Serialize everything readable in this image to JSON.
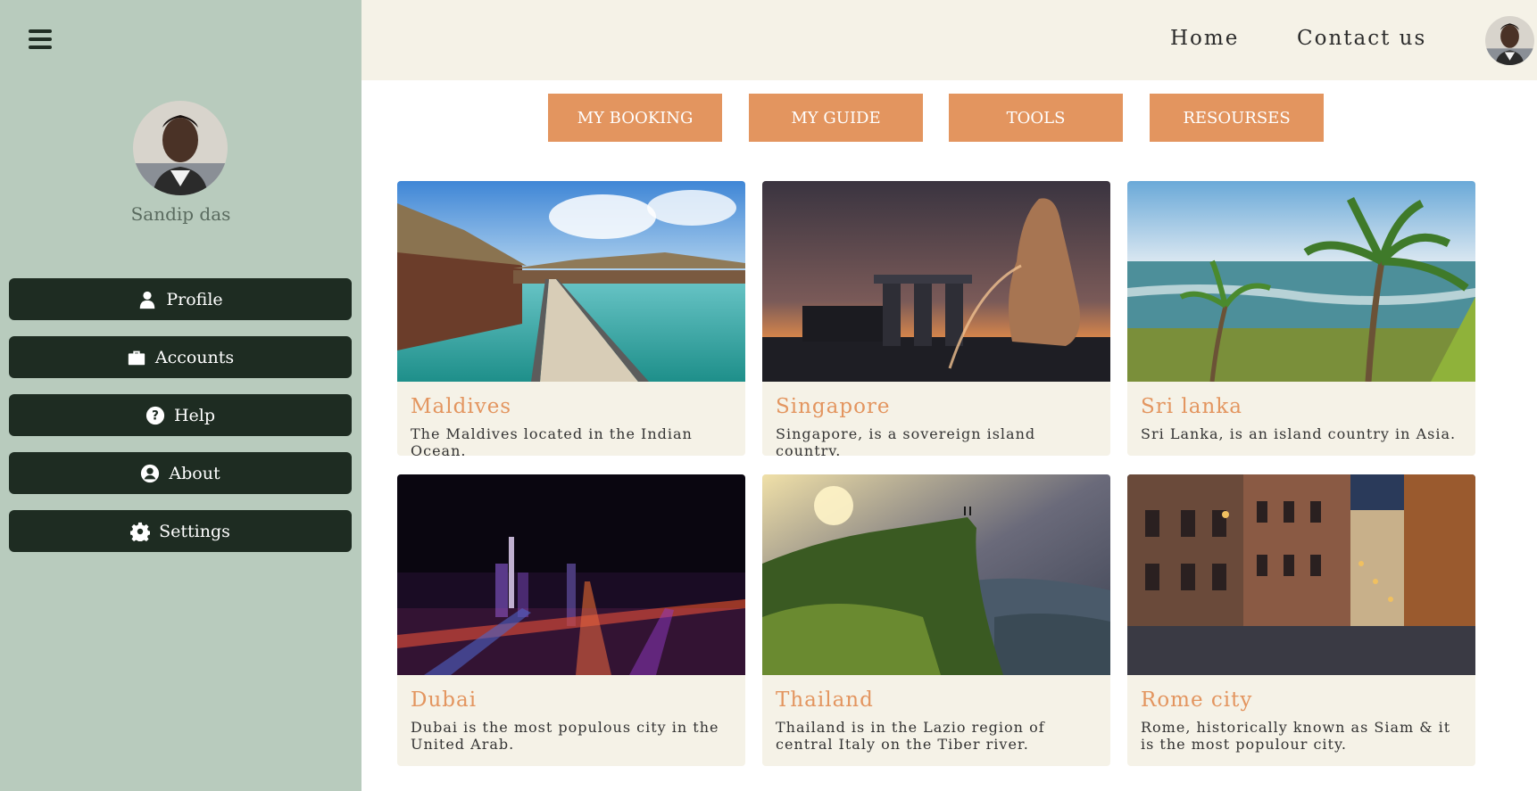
{
  "sidebar": {
    "menu_icon": "hamburger-icon",
    "user_name": "Sandip das",
    "items": [
      {
        "label": "Profile",
        "icon": "user-icon"
      },
      {
        "label": "Accounts",
        "icon": "briefcase-icon"
      },
      {
        "label": "Help",
        "icon": "question-icon"
      },
      {
        "label": "About",
        "icon": "user-circle-icon"
      },
      {
        "label": "Settings",
        "icon": "gear-icon"
      }
    ]
  },
  "header": {
    "nav": [
      {
        "label": "Home"
      },
      {
        "label": "Contact us"
      }
    ]
  },
  "tabs": [
    {
      "label": "MY BOOKING"
    },
    {
      "label": "MY GUIDE"
    },
    {
      "label": "TOOLS"
    },
    {
      "label": "RESOURSES"
    }
  ],
  "cards": [
    {
      "title": "Maldives",
      "text": "The Maldives located in the Indian Ocean."
    },
    {
      "title": "Singapore",
      "text": "Singapore, is a sovereign island country."
    },
    {
      "title": "Sri lanka",
      "text": "Sri Lanka, is an island country in Asia."
    },
    {
      "title": "Dubai",
      "text": "Dubai is the most populous city in the United Arab."
    },
    {
      "title": "Thailand",
      "text": "Thailand is in the Lazio region of central Italy on the Tiber river."
    },
    {
      "title": "Rome city",
      "text": "Rome, historically known as Siam & it is the most populour city."
    }
  ],
  "colors": {
    "sidebar_bg": "#b8cbbd",
    "menu_button_bg": "#1e2c22",
    "header_bg": "#f5f2e7",
    "accent": "#e3955f",
    "card_bg": "#f5f2e7"
  }
}
